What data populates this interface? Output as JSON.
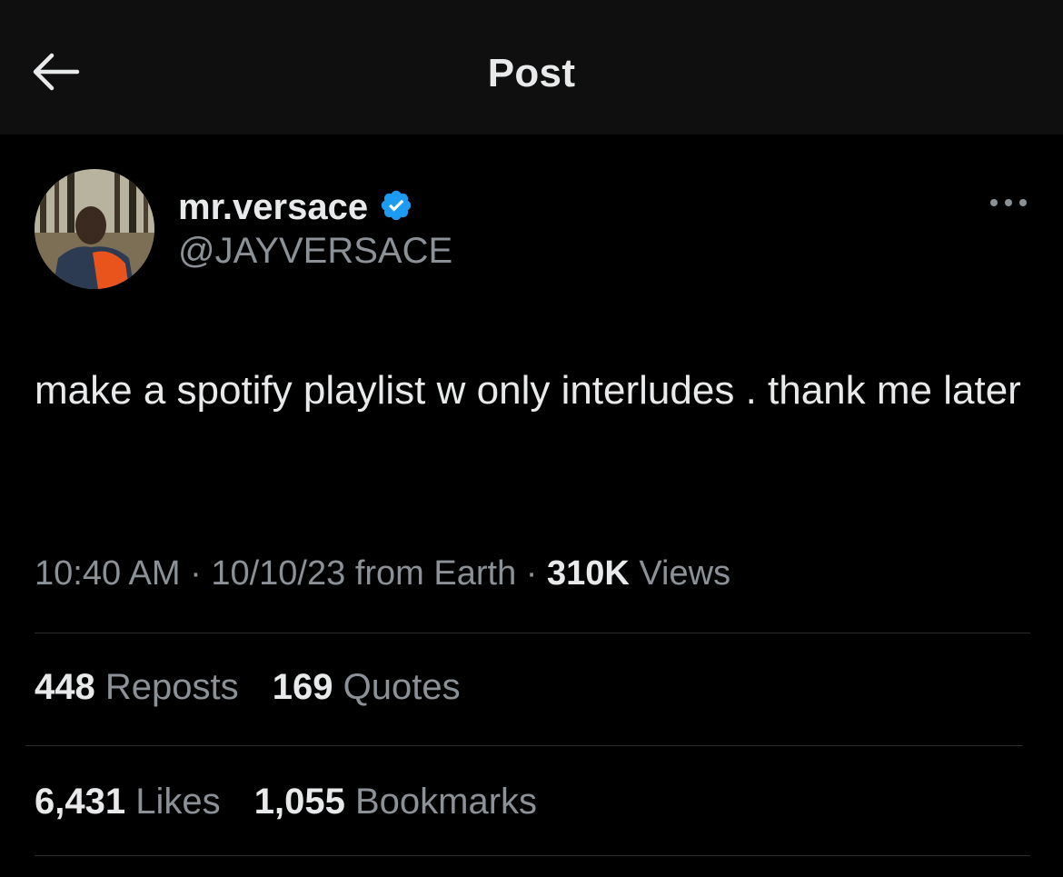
{
  "header": {
    "title": "Post",
    "back_icon": "arrow-left-icon"
  },
  "author": {
    "display_name": "mr.versace",
    "verified": true,
    "verified_color": "#1d9bf0",
    "handle": "@JAYVERSACE",
    "more_icon": "more-horizontal-icon"
  },
  "post": {
    "text": "make a spotify playlist w only interludes . thank me later",
    "time": "10:40 AM",
    "separator": "·",
    "date_source": "10/10/23 from Earth",
    "views_count": "310K",
    "views_label": "Views"
  },
  "stats": {
    "reposts": {
      "count": "448",
      "label": "Reposts"
    },
    "quotes": {
      "count": "169",
      "label": "Quotes"
    },
    "likes": {
      "count": "6,431",
      "label": "Likes"
    },
    "bookmarks": {
      "count": "1,055",
      "label": "Bookmarks"
    }
  },
  "colors": {
    "background": "#000000",
    "header_background": "#0f0f0f",
    "primary_text": "#e7e9ea",
    "secondary_text": "#8b9197",
    "divider": "#2a2d30"
  }
}
